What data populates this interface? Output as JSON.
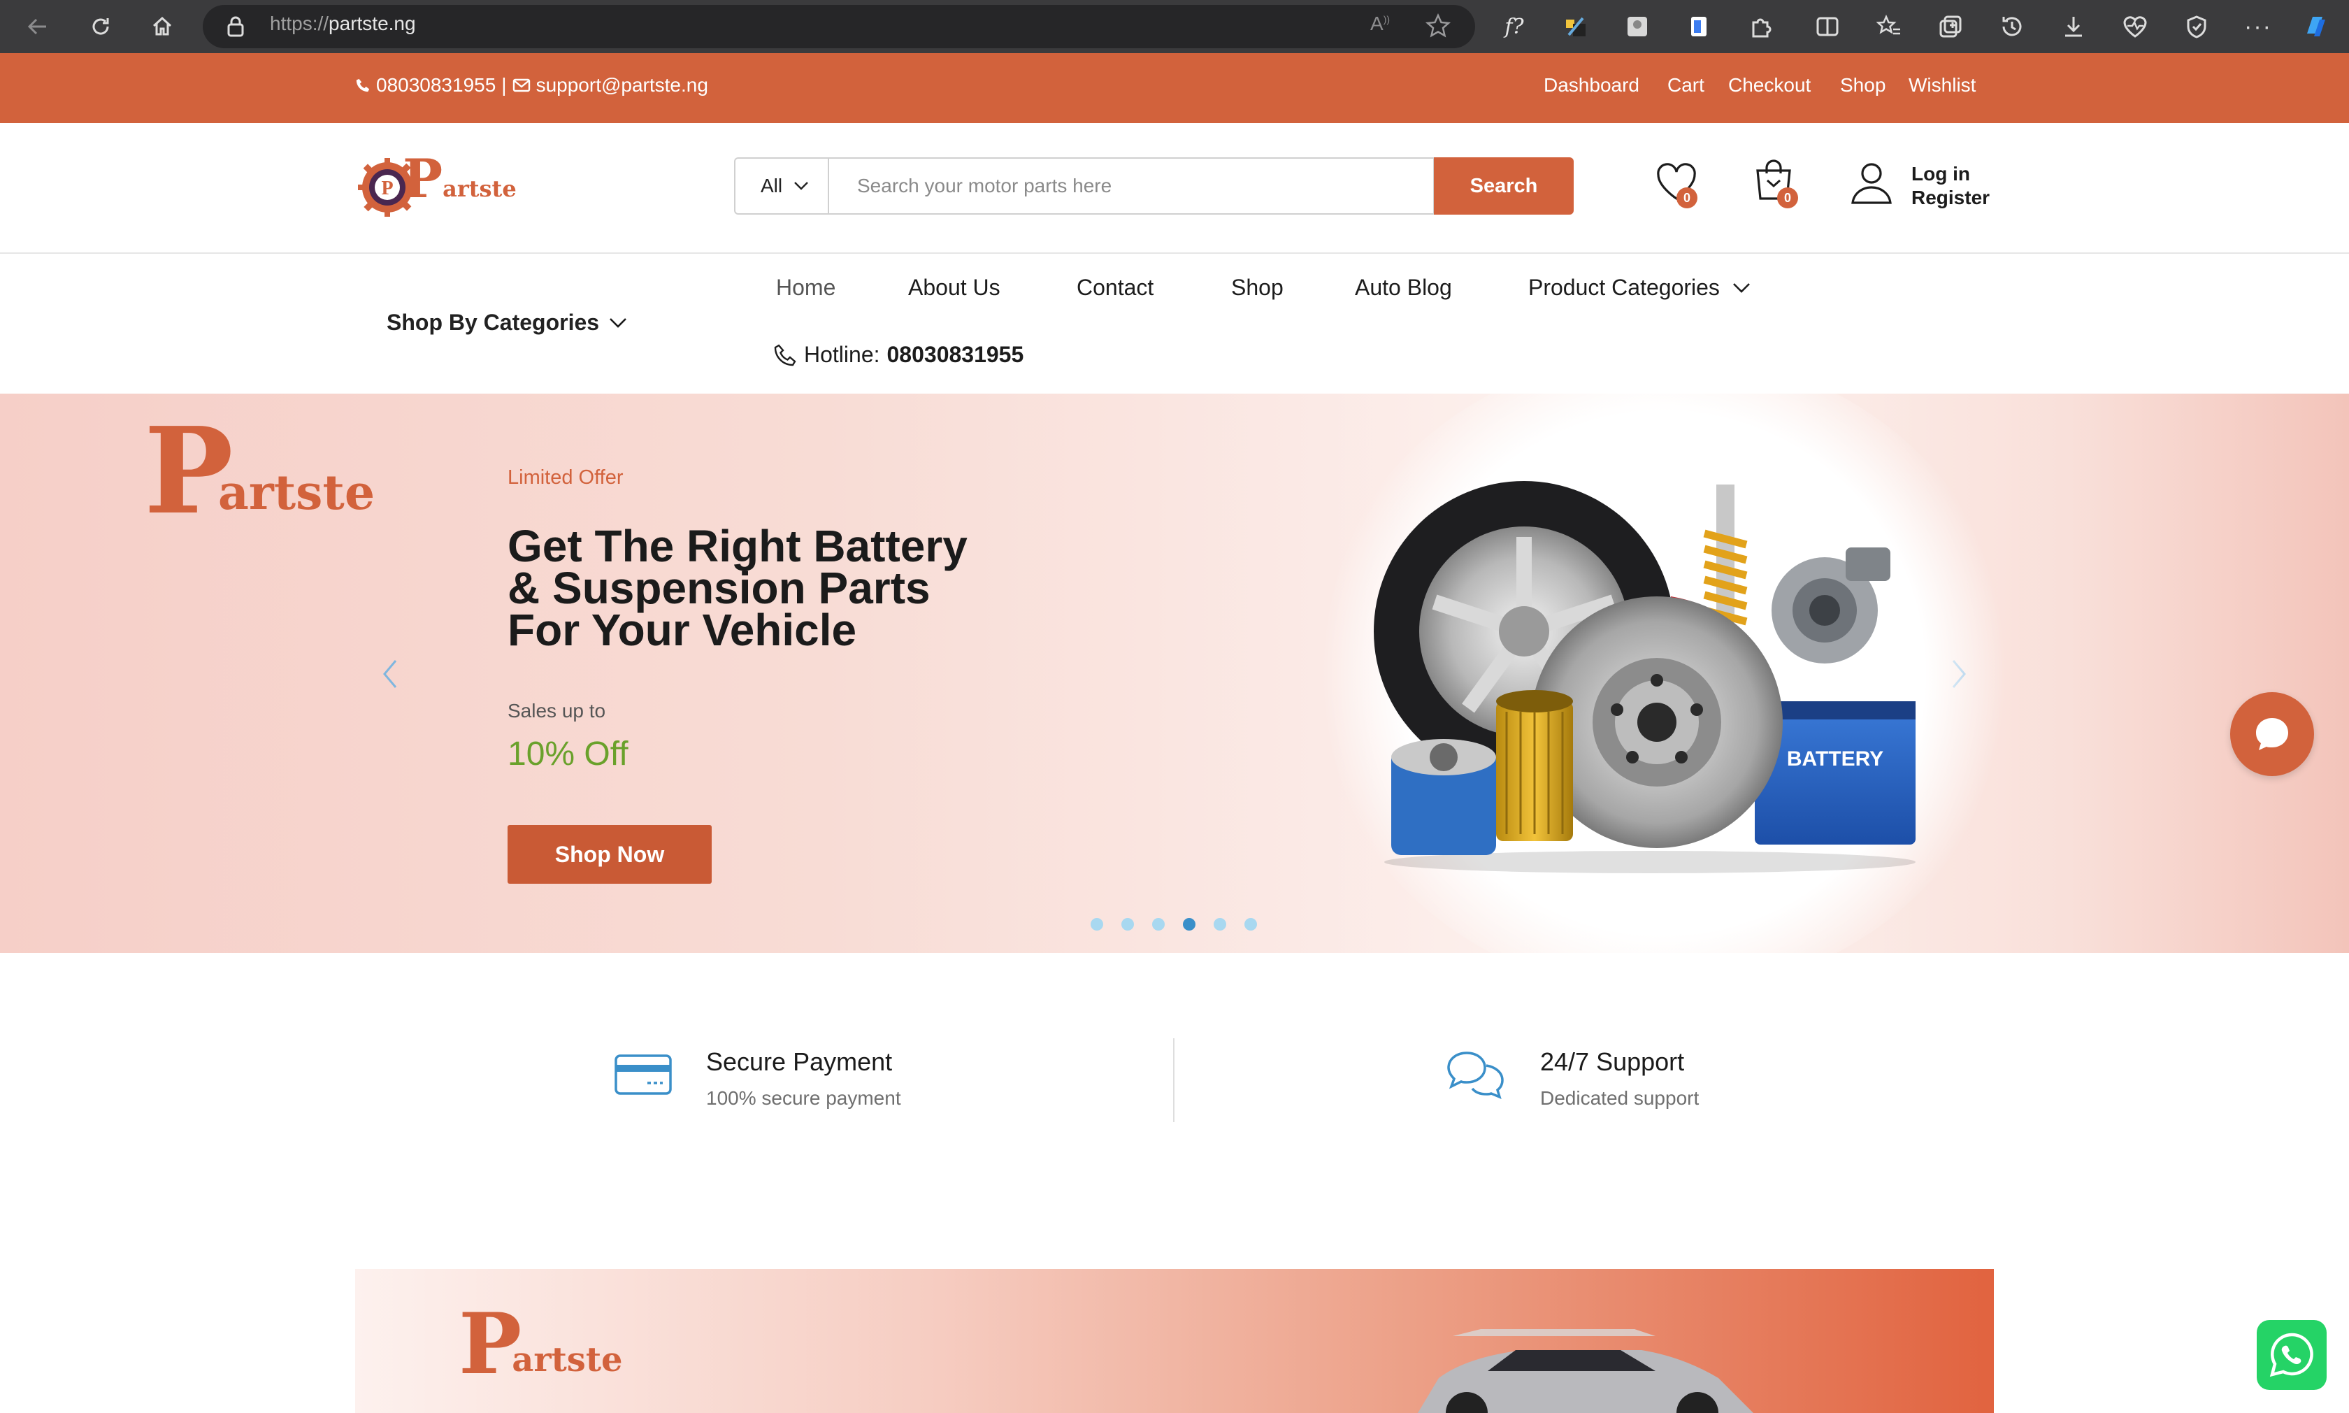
{
  "browser": {
    "url": "https://partste.ng",
    "url_prefix": "https://",
    "url_host": "partste.ng"
  },
  "topbar": {
    "phone": "08030831955",
    "separator": "|",
    "email": "support@partste.ng",
    "links": [
      "Dashboard",
      "Cart",
      "Checkout",
      "Shop",
      "Wishlist"
    ]
  },
  "header": {
    "logo_text": "artste",
    "search": {
      "category": "All",
      "placeholder": "Search your motor parts here",
      "button": "Search"
    },
    "wishlist_count": "0",
    "cart_count": "0",
    "login": "Log in",
    "register": "Register"
  },
  "nav": {
    "categories_label": "Shop By Categories",
    "links": [
      "Home",
      "About Us",
      "Contact",
      "Shop",
      "Auto Blog",
      "Product Categories"
    ],
    "hotline_label": "Hotline:",
    "hotline_number": "08030831955"
  },
  "hero": {
    "logo_text": "artste",
    "eyebrow": "Limited Offer",
    "title_line1": "Get The Right Battery",
    "title_line2": "& Suspension Parts",
    "title_line3": "For Your Vehicle",
    "sales_label": "Sales up to",
    "discount": "10% Off",
    "cta": "Shop Now",
    "battery_label": "BATTERY",
    "slide_count": 6,
    "active_slide": 4
  },
  "features": [
    {
      "title": "Secure Payment",
      "subtitle": "100% secure payment",
      "icon": "credit-card-icon"
    },
    {
      "title": "24/7 Support",
      "subtitle": "Dedicated support",
      "icon": "chat-bubbles-icon"
    }
  ],
  "banner": {
    "logo_text": "artste"
  },
  "colors": {
    "brand": "#d2623c",
    "discount_green": "#6aa12b",
    "icon_blue": "#3a8fc9"
  }
}
